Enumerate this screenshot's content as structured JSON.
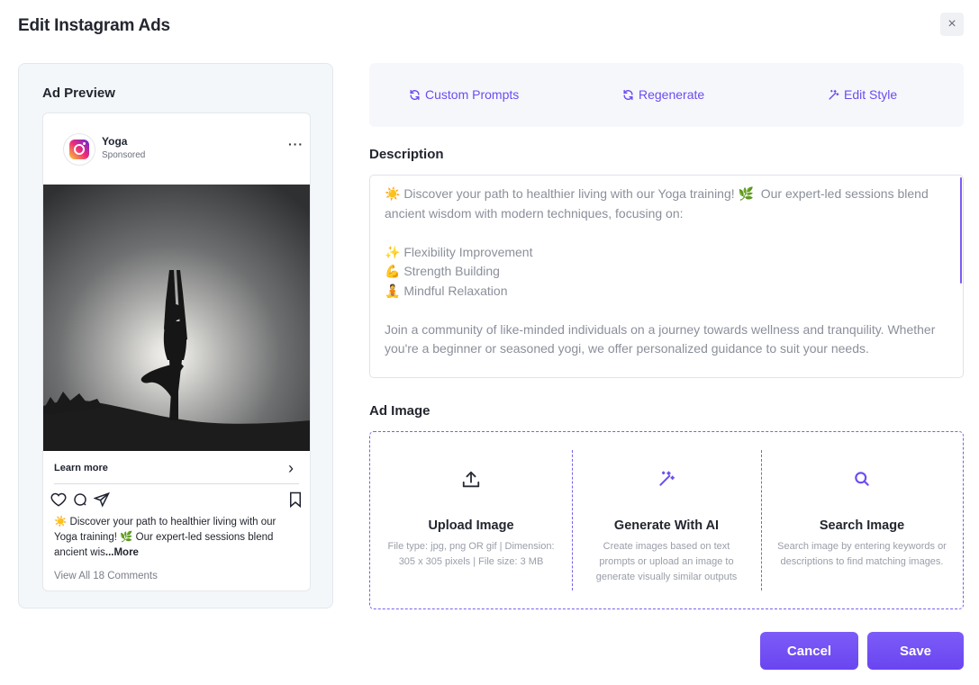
{
  "dialog": {
    "title": "Edit Instagram Ads",
    "close_icon": "×"
  },
  "preview": {
    "title": "Ad Preview",
    "account_name": "Yoga",
    "sponsored": "Sponsored",
    "more_dots": "···",
    "learn_more": "Learn more",
    "learn_more_arrow": "›",
    "caption_text": "☀️ Discover your path to healthier living with our Yoga training! 🌿 Our expert-led sessions blend ancient wis",
    "caption_more": "...More",
    "comments": "View All 18 Comments"
  },
  "toolbar": {
    "custom_prompts": "Custom Prompts",
    "regenerate": "Regenerate",
    "edit_style": "Edit Style"
  },
  "description": {
    "label": "Description",
    "value": "☀️ Discover your path to healthier living with our Yoga training! 🌿  Our expert-led sessions blend ancient wisdom with modern techniques, focusing on:\n\n✨ Flexibility Improvement\n💪 Strength Building\n🧘 Mindful Relaxation\n\nJoin a community of like-minded individuals on a journey towards wellness and tranquility. Whether you're a beginner or seasoned yogi, we offer personalized guidance to suit your needs."
  },
  "ad_image": {
    "label": "Ad Image",
    "upload": {
      "title": "Upload Image",
      "sub": "File type: jpg, png OR gif | Dimension: 305 x 305 pixels | File size: 3 MB"
    },
    "generate": {
      "title": "Generate With AI",
      "sub": "Create images based on text prompts or upload an image to generate visually similar outputs"
    },
    "search": {
      "title": "Search Image",
      "sub": "Search image by entering keywords or descriptions to find matching images."
    }
  },
  "actions": {
    "cancel": "Cancel",
    "save": "Save"
  },
  "colors": {
    "accent": "#6c4cf0",
    "panel_bg": "#f3f7fa",
    "toolbar_bg": "#f5f7fb"
  }
}
